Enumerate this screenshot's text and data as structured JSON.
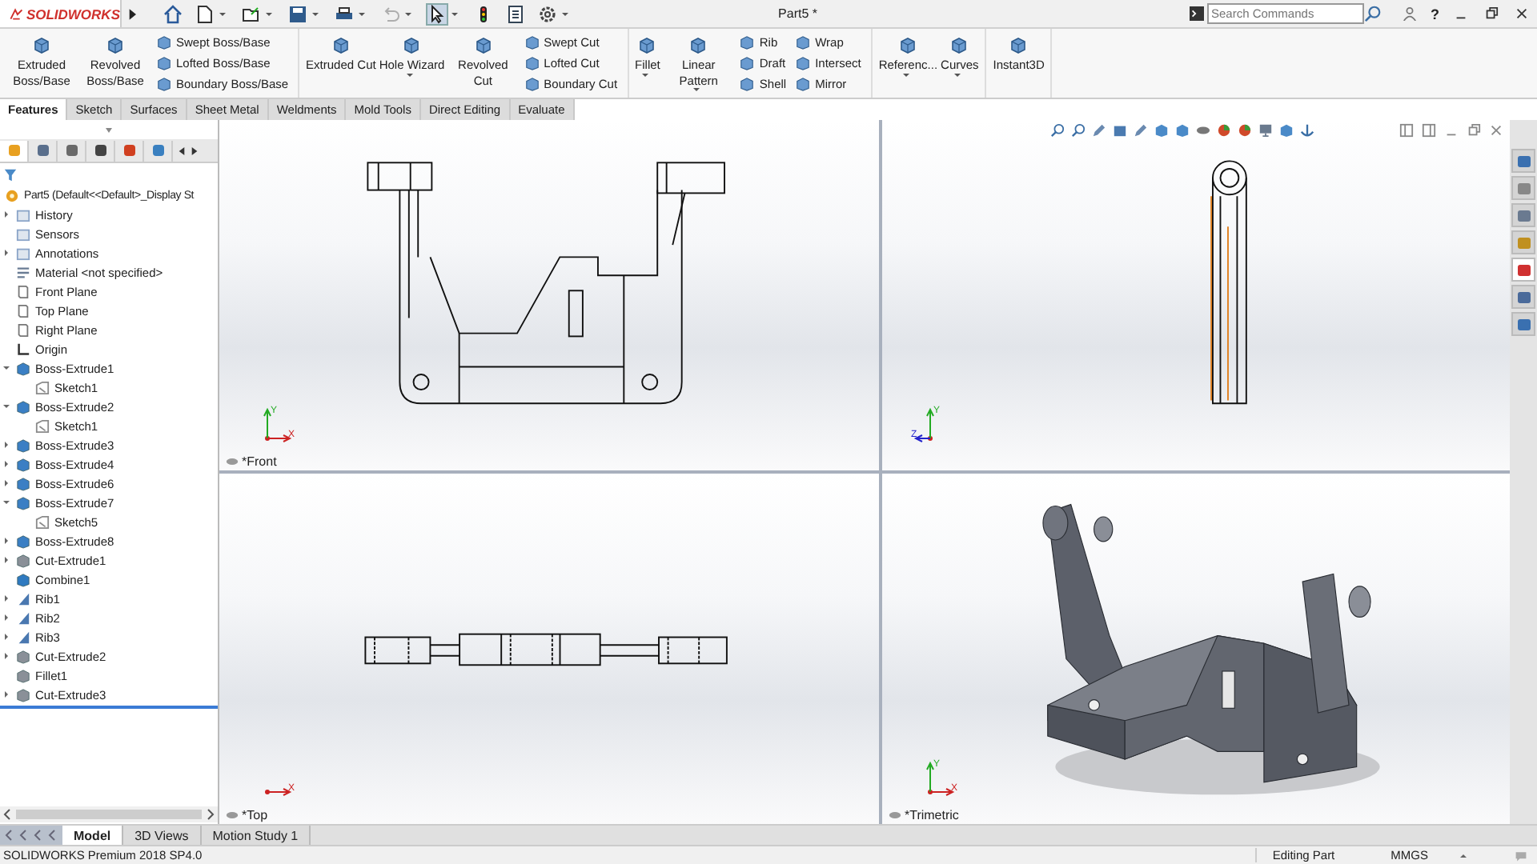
{
  "title_bar": {
    "logo_text": "SOLIDWORKS",
    "document_title": "Part5 *",
    "search": {
      "placeholder": "Search Commands"
    },
    "help": "?"
  },
  "quick_access": [
    {
      "kind": "home",
      "dropdown": false,
      "disabled": false,
      "selected": false
    },
    {
      "kind": "new",
      "dropdown": true,
      "disabled": false,
      "selected": false
    },
    {
      "kind": "open",
      "dropdown": true,
      "disabled": false,
      "selected": false
    },
    {
      "kind": "save",
      "dropdown": true,
      "disabled": false,
      "selected": false
    },
    {
      "kind": "print",
      "dropdown": true,
      "disabled": false,
      "selected": false
    },
    {
      "kind": "undo",
      "dropdown": true,
      "disabled": true,
      "selected": false
    },
    {
      "kind": "select",
      "dropdown": true,
      "disabled": false,
      "selected": true
    },
    {
      "kind": "rebuild",
      "dropdown": false,
      "disabled": false,
      "selected": false
    },
    {
      "kind": "properties",
      "dropdown": false,
      "disabled": false,
      "selected": false
    },
    {
      "kind": "options",
      "dropdown": true,
      "disabled": false,
      "selected": false
    }
  ],
  "ribbon": [
    {
      "items": [
        {
          "kind": "large",
          "label": "Extruded Boss/Base",
          "dropdown": false
        },
        {
          "kind": "large",
          "label": "Revolved Boss/Base",
          "dropdown": false
        },
        {
          "kind": "stack",
          "items": [
            "Swept Boss/Base",
            "Lofted Boss/Base",
            "Boundary Boss/Base"
          ]
        }
      ]
    },
    {
      "items": [
        {
          "kind": "large",
          "label": "Extruded Cut",
          "dropdown": false
        },
        {
          "kind": "large",
          "label": "Hole Wizard",
          "dropdown": true
        },
        {
          "kind": "large",
          "label": "Revolved Cut",
          "dropdown": false
        },
        {
          "kind": "stack",
          "items": [
            "Swept Cut",
            "Lofted Cut",
            "Boundary Cut"
          ]
        }
      ]
    },
    {
      "items": [
        {
          "kind": "large",
          "label": "Fillet",
          "dropdown": true
        },
        {
          "kind": "large",
          "label": "Linear Pattern",
          "dropdown": true
        },
        {
          "kind": "stack",
          "items": [
            "Rib",
            "Draft",
            "Shell"
          ]
        },
        {
          "kind": "stack",
          "items": [
            "Wrap",
            "Intersect",
            "Mirror"
          ]
        }
      ]
    },
    {
      "items": [
        {
          "kind": "large",
          "label": "Referenc...",
          "dropdown": true
        },
        {
          "kind": "large",
          "label": "Curves",
          "dropdown": true
        }
      ]
    },
    {
      "items": [
        {
          "kind": "large",
          "label": "Instant3D",
          "dropdown": false
        }
      ]
    }
  ],
  "feature_tabs": [
    {
      "label": "Features",
      "selected": true
    },
    {
      "label": "Sketch",
      "selected": false
    },
    {
      "label": "Surfaces",
      "selected": false
    },
    {
      "label": "Sheet Metal",
      "selected": false
    },
    {
      "label": "Weldments",
      "selected": false
    },
    {
      "label": "Mold Tools",
      "selected": false
    },
    {
      "label": "Direct Editing",
      "selected": false
    },
    {
      "label": "Evaluate",
      "selected": false
    }
  ],
  "panel_tabs": [
    {
      "kind": "feature-tree",
      "selected": true
    },
    {
      "kind": "property",
      "selected": false
    },
    {
      "kind": "configuration",
      "selected": false
    },
    {
      "kind": "dimxpert",
      "selected": false
    },
    {
      "kind": "display",
      "selected": false
    },
    {
      "kind": "cam",
      "selected": false
    }
  ],
  "tree": {
    "root": {
      "label": "Part5  (Default<<Default>_Display St",
      "kind": "part"
    },
    "items": [
      {
        "label": "History",
        "kind": "folder",
        "expanded": false
      },
      {
        "label": "Sensors",
        "kind": "folder"
      },
      {
        "label": "Annotations",
        "kind": "folder",
        "expanded": false
      },
      {
        "label": "Material <not specified>",
        "kind": "material"
      },
      {
        "label": "Front Plane",
        "kind": "plane"
      },
      {
        "label": "Top Plane",
        "kind": "plane"
      },
      {
        "label": "Right Plane",
        "kind": "plane"
      },
      {
        "label": "Origin",
        "kind": "origin"
      },
      {
        "label": "Boss-Extrude1",
        "kind": "boss",
        "expanded": true,
        "children": [
          {
            "label": "Sketch1",
            "kind": "sketch"
          }
        ]
      },
      {
        "label": "Boss-Extrude2",
        "kind": "boss",
        "expanded": true,
        "children": [
          {
            "label": "Sketch1",
            "kind": "sketch"
          }
        ]
      },
      {
        "label": "Boss-Extrude3",
        "kind": "boss",
        "expanded": false
      },
      {
        "label": "Boss-Extrude4",
        "kind": "boss",
        "expanded": false
      },
      {
        "label": "Boss-Extrude6",
        "kind": "boss",
        "expanded": false
      },
      {
        "label": "Boss-Extrude7",
        "kind": "boss",
        "expanded": true,
        "children": [
          {
            "label": "Sketch5",
            "kind": "sketch"
          }
        ]
      },
      {
        "label": "Boss-Extrude8",
        "kind": "boss",
        "expanded": false
      },
      {
        "label": "Cut-Extrude1",
        "kind": "cut",
        "expanded": false
      },
      {
        "label": "Combine1",
        "kind": "combine"
      },
      {
        "label": "Rib1",
        "kind": "rib",
        "expanded": false
      },
      {
        "label": "Rib2",
        "kind": "rib",
        "expanded": false
      },
      {
        "label": "Rib3",
        "kind": "rib",
        "expanded": false
      },
      {
        "label": "Cut-Extrude2",
        "kind": "cut",
        "expanded": false
      },
      {
        "label": "Fillet1",
        "kind": "fillet"
      },
      {
        "label": "Cut-Extrude3",
        "kind": "cut",
        "expanded": false
      }
    ]
  },
  "views": [
    {
      "kind": "front",
      "label": "*Front",
      "triad": {
        "up": "Y",
        "right": "X"
      }
    },
    {
      "kind": "right",
      "triad": {
        "up": "Y",
        "left": "Z"
      }
    },
    {
      "kind": "top",
      "label": "*Top",
      "triad": {
        "right": "X"
      }
    },
    {
      "kind": "trimetric",
      "label": "*Trimetric",
      "triad": {
        "up": "Y",
        "right": "X"
      }
    }
  ],
  "task_pane": [
    {
      "kind": "home",
      "selected": false
    },
    {
      "kind": "library",
      "selected": false
    },
    {
      "kind": "folder",
      "selected": false
    },
    {
      "kind": "palette",
      "selected": false
    },
    {
      "kind": "appearance",
      "selected": true
    },
    {
      "kind": "properties",
      "selected": false
    },
    {
      "kind": "forum",
      "selected": false
    }
  ],
  "bottom_tabs": [
    {
      "label": "Model",
      "selected": true
    },
    {
      "label": "3D Views",
      "selected": false
    },
    {
      "label": "Motion Study 1",
      "selected": false
    }
  ],
  "status_bar": {
    "product": "SOLIDWORKS Premium 2018 SP4.0",
    "mode": "Editing Part",
    "units": "MMGS"
  }
}
